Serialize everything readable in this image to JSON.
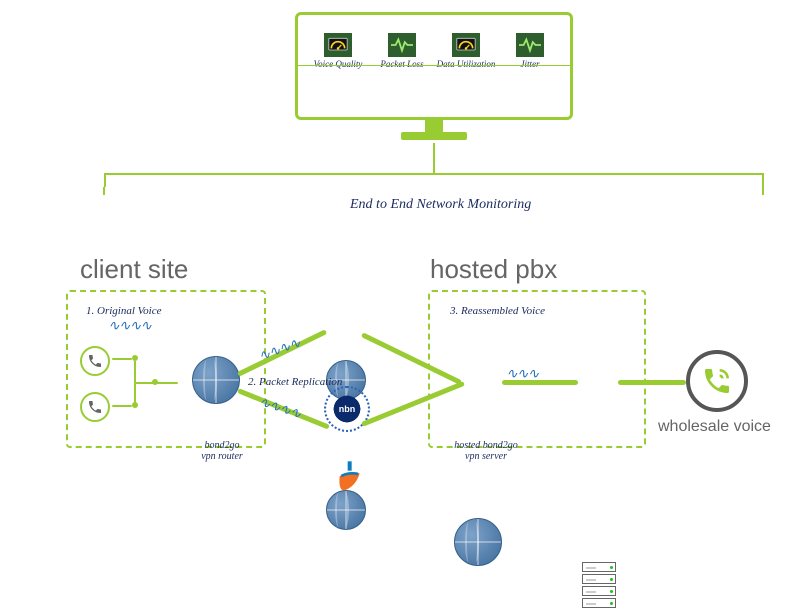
{
  "monitor": {
    "metrics": [
      {
        "label": "Voice Quality",
        "icon": "gauge"
      },
      {
        "label": "Packet Loss",
        "icon": "pulse"
      },
      {
        "label": "Data Utilization",
        "icon": "gauge"
      },
      {
        "label": "Jitter",
        "icon": "pulse"
      }
    ]
  },
  "bracket_label": "End to End Network Monitoring",
  "sections": {
    "client_site": "client site",
    "hosted_pbx": "hosted pbx"
  },
  "annotations": {
    "step1": "1. Original Voice",
    "step2": "2. Packet Replication",
    "step3": "3. Reassembled Voice"
  },
  "labels": {
    "router": "bond2go\nvpn router",
    "server": "hosted bond2go\nvpn server",
    "wholesale": "wholesale voice",
    "nbn": "nbn"
  },
  "colors": {
    "accent": "#99cc33",
    "text_dark": "#1a2a5e",
    "text_gray": "#656565",
    "blue": "#2a73c0"
  }
}
